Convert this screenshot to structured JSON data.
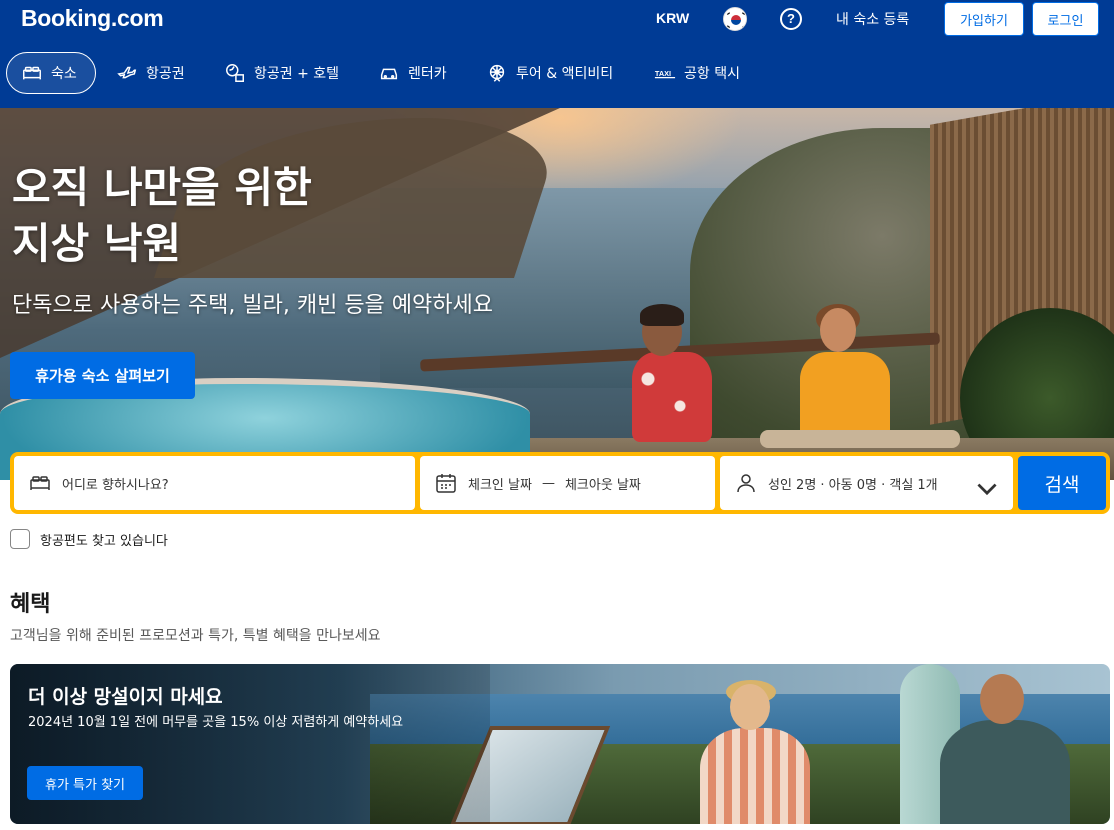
{
  "header": {
    "logo": "Booking.com",
    "currency": "KRW",
    "help": "?",
    "list_property": "내 숙소 등록",
    "register": "가입하기",
    "login": "로그인"
  },
  "nav": {
    "items": [
      {
        "label": "숙소",
        "icon": "bed-icon",
        "active": true
      },
      {
        "label": "항공권",
        "icon": "plane-icon",
        "active": false
      },
      {
        "label": "항공권 + 호텔",
        "icon": "plane-hotel-icon",
        "active": false
      },
      {
        "label": "렌터카",
        "icon": "car-icon",
        "active": false
      },
      {
        "label": "투어 & 액티비티",
        "icon": "attractions-icon",
        "active": false
      },
      {
        "label": "공항 택시",
        "icon": "taxi-icon",
        "active": false
      }
    ]
  },
  "hero": {
    "title_line1": "오직 나만을 위한",
    "title_line2": "지상 낙원",
    "subtitle": "단독으로 사용하는 주택, 빌라, 캐빈 등을 예약하세요",
    "cta": "휴가용 숙소 살펴보기"
  },
  "search": {
    "destination_placeholder": "어디로 향하시나요?",
    "checkin": "체크인 날짜",
    "date_separator": "—",
    "checkout": "체크아웃 날짜",
    "guests": "성인 2명 · 아동 0명 · 객실 1개",
    "button": "검색"
  },
  "flight_checkbox": {
    "label": "항공편도 찾고 있습니다",
    "checked": false
  },
  "deals": {
    "title": "혜택",
    "subtitle": "고객님을 위해 준비된 프로모션과 특가, 특별 혜택을 만나보세요",
    "promo": {
      "title": "더 이상 망설이지 마세요",
      "description": "2024년 10월 1일 전에 머무를 곳을 15% 이상 저렴하게 예약하세요",
      "cta": "휴가 특가 찾기"
    }
  },
  "colors": {
    "brand_blue": "#003b95",
    "action_blue": "#006ce4",
    "search_yellow": "#ffb700"
  }
}
